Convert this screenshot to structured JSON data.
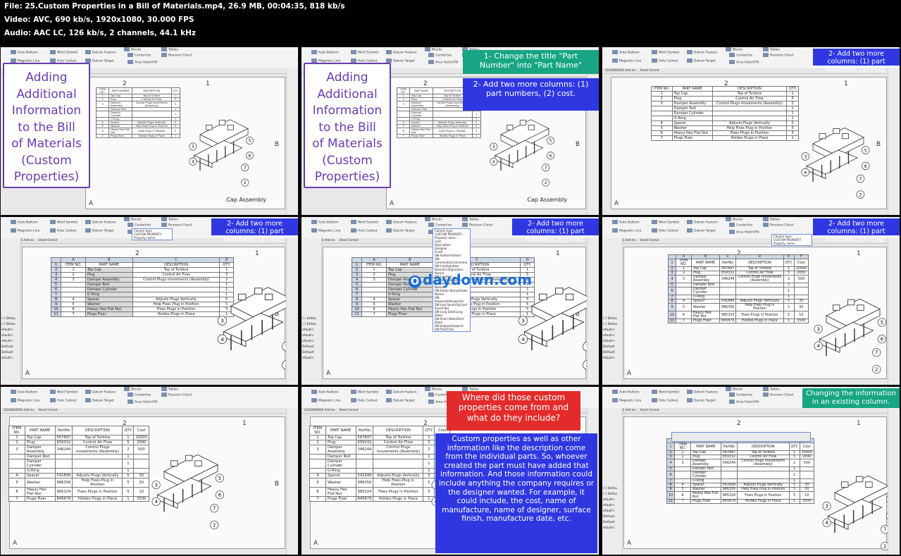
{
  "file_info": {
    "line1": "File: 25.Custom Properties in a Bill of Materials.mp4, 26.9 MB, 00:04:35, 818 kb/s",
    "line2": "Video: AVC, 690 kb/s, 1920x1080, 30.000 FPS",
    "line3": "Audio: AAC LC, 126 kb/s, 2 channels, 44.1 kHz"
  },
  "title_card": {
    "lines": [
      "Adding",
      "Additional",
      "Information",
      "to the Bill",
      "of Materials",
      "(Custom",
      "Properties)"
    ]
  },
  "callouts": {
    "change_title": "1- Change the title \"Part Number\" into \"Part Name\"",
    "add_columns_full": "2- Add two more columns: (1) part numbers, (2) cost.",
    "add_columns_short": "2- Add two more columns: (1) part numbers, (2) cost.",
    "where_from": "Where did those custom properties come from and what do they include?",
    "explanation": "Custom properties as well as other information like the description come from the individual parts. So, whoever created the part must have added that information. And those information could include anything the company requires or the designer wanted. For example, it could include, the cost, name of manufacture, name of designer, surface finish, manufacture date, etc.",
    "changing_info": "Changing the information in an existing column."
  },
  "ribbon": {
    "auto_balloon": "Auto Balloon",
    "magnetic_line": "Magnetic Line",
    "weld_symbol": "Weld Symbol",
    "hole_callout": "Hole Callout",
    "datum_feature": "Datum Feature",
    "datum_target": "Datum Target",
    "centerline": "Centerline",
    "area_hatch": "Area Hatch/Fill",
    "revision_cloud": "Revision Cloud",
    "blocks": "Blocks",
    "tables": "Tables",
    "tab_addins": "SOLIDWORKS Add-Ins",
    "tab_sheet_format": "Sheet Format"
  },
  "column_popup": {
    "column_type": "Column type",
    "custom_property": "CUSTOM PROPERTY",
    "property_name": "Property name:"
  },
  "dropdown_items": [
    "Cost",
    "Description",
    "Designer",
    "Finish",
    "SW-Author(Author)",
    "SW-Comments(Comments)",
    "SW-Configuration Name(Configuration Name)",
    "SW-Created Date(Created Date)",
    "SW-File Name(File Name)",
    "SW-Folder Name(Folder Name)",
    "SW-Keywords(Keywords)",
    "SW-Last Saved By(Last Saved By)",
    "SW-Long Date(Long Date)",
    "SW-Short Date(Short Date)",
    "SW-Subject(Subject)",
    "SW-Title(Title)"
  ],
  "bom": {
    "headers_original": [
      "ITEM NO.",
      "PART NUMBER",
      "DESCRIPTION",
      "QTY."
    ],
    "headers_renamed": [
      "ITEM NO.",
      "PART NAME",
      "DESCRIPTION",
      "QTY."
    ],
    "headers_final": [
      "ITEM NO.",
      "PART NAME",
      "PartNo",
      "DESCRIPTION",
      "QTY.",
      "Cost"
    ],
    "col_letters": [
      "A",
      "B",
      "C",
      "D",
      "E",
      "F"
    ],
    "rows": [
      {
        "item": "1",
        "name": "Top Cap",
        "partno": "567897",
        "desc": "Top of Turbine",
        "qty": "1",
        "cost": "10000"
      },
      {
        "item": "2",
        "name": "Plug",
        "partno": "659332",
        "desc": "Control Air Flow",
        "qty": "5",
        "cost": "2000"
      },
      {
        "item": "3",
        "name": "Damper Assembly",
        "partno": "346244",
        "desc": "Control Plugs movements (Assembly)",
        "qty": "2",
        "cost": "500"
      },
      {
        "item": "",
        "name": "Damper Rod",
        "partno": "",
        "desc": "",
        "qty": "1",
        "cost": ""
      },
      {
        "item": "",
        "name": "Damper Cylinder",
        "partno": "",
        "desc": "",
        "qty": "1",
        "cost": ""
      },
      {
        "item": "",
        "name": "O-Ring",
        "partno": "",
        "desc": "",
        "qty": "1",
        "cost": ""
      },
      {
        "item": "4",
        "name": "Spacer",
        "partno": "541899",
        "desc": "Adjusts Plugs Vertically",
        "qty": "5",
        "cost": "30"
      },
      {
        "item": "5",
        "name": "Washer",
        "partno": "986356",
        "desc": "Help Fixes Plug in Position",
        "qty": "5",
        "cost": "30"
      },
      {
        "item": "6",
        "name": "Heavy Hex Flat Nut",
        "partno": "985324",
        "desc": "Fixes Plugs in Position",
        "qty": "5",
        "cost": "10"
      },
      {
        "item": "7",
        "name": "Plugs Fixer",
        "partno": "845679",
        "desc": "Holdes Plugs in Place",
        "qty": "1",
        "cost": "3500"
      }
    ]
  },
  "sheet": {
    "zone_b": "B",
    "zone_a": "A",
    "col_2": "2",
    "col_1": "1",
    "cap_assembly": "Cap Assembly",
    "balloons": [
      "2",
      "3",
      "4",
      "5",
      "6",
      "7"
    ]
  },
  "left_panel_lines": [
    "(-) Defau",
    "(-) Defau",
    "efault<",
    "efault<",
    "efault<",
    "Default",
    "Default",
    "efault<"
  ],
  "watermark": "0daydown.com"
}
